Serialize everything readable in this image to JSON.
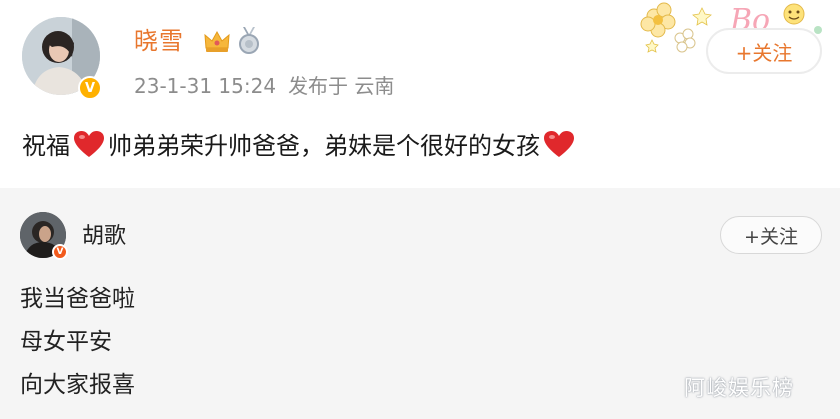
{
  "post": {
    "username": "晓雪",
    "timestamp": "23-1-31 15:24",
    "source": "发布于 云南",
    "follow_label": "+关注",
    "text_segments": [
      "祝福",
      "帅弟弟荣升帅爸爸，弟妹是个很好的女孩"
    ],
    "icons": [
      "crown-icon",
      "medal-icon",
      "heart-icon",
      "verified-badge-icon"
    ]
  },
  "repost": {
    "username": "胡歌",
    "follow_label": "+关注",
    "lines": [
      "我当爸爸啦",
      "母女平安",
      "向大家报喜"
    ]
  },
  "watermark": "阿峻娱乐榜",
  "colors": {
    "username_orange": "#e8772e",
    "meta_gray": "#8c8c8c",
    "card_background": "#f5f5f5",
    "heart_red": "#e0282c",
    "verify_gold": "#ffb100"
  }
}
